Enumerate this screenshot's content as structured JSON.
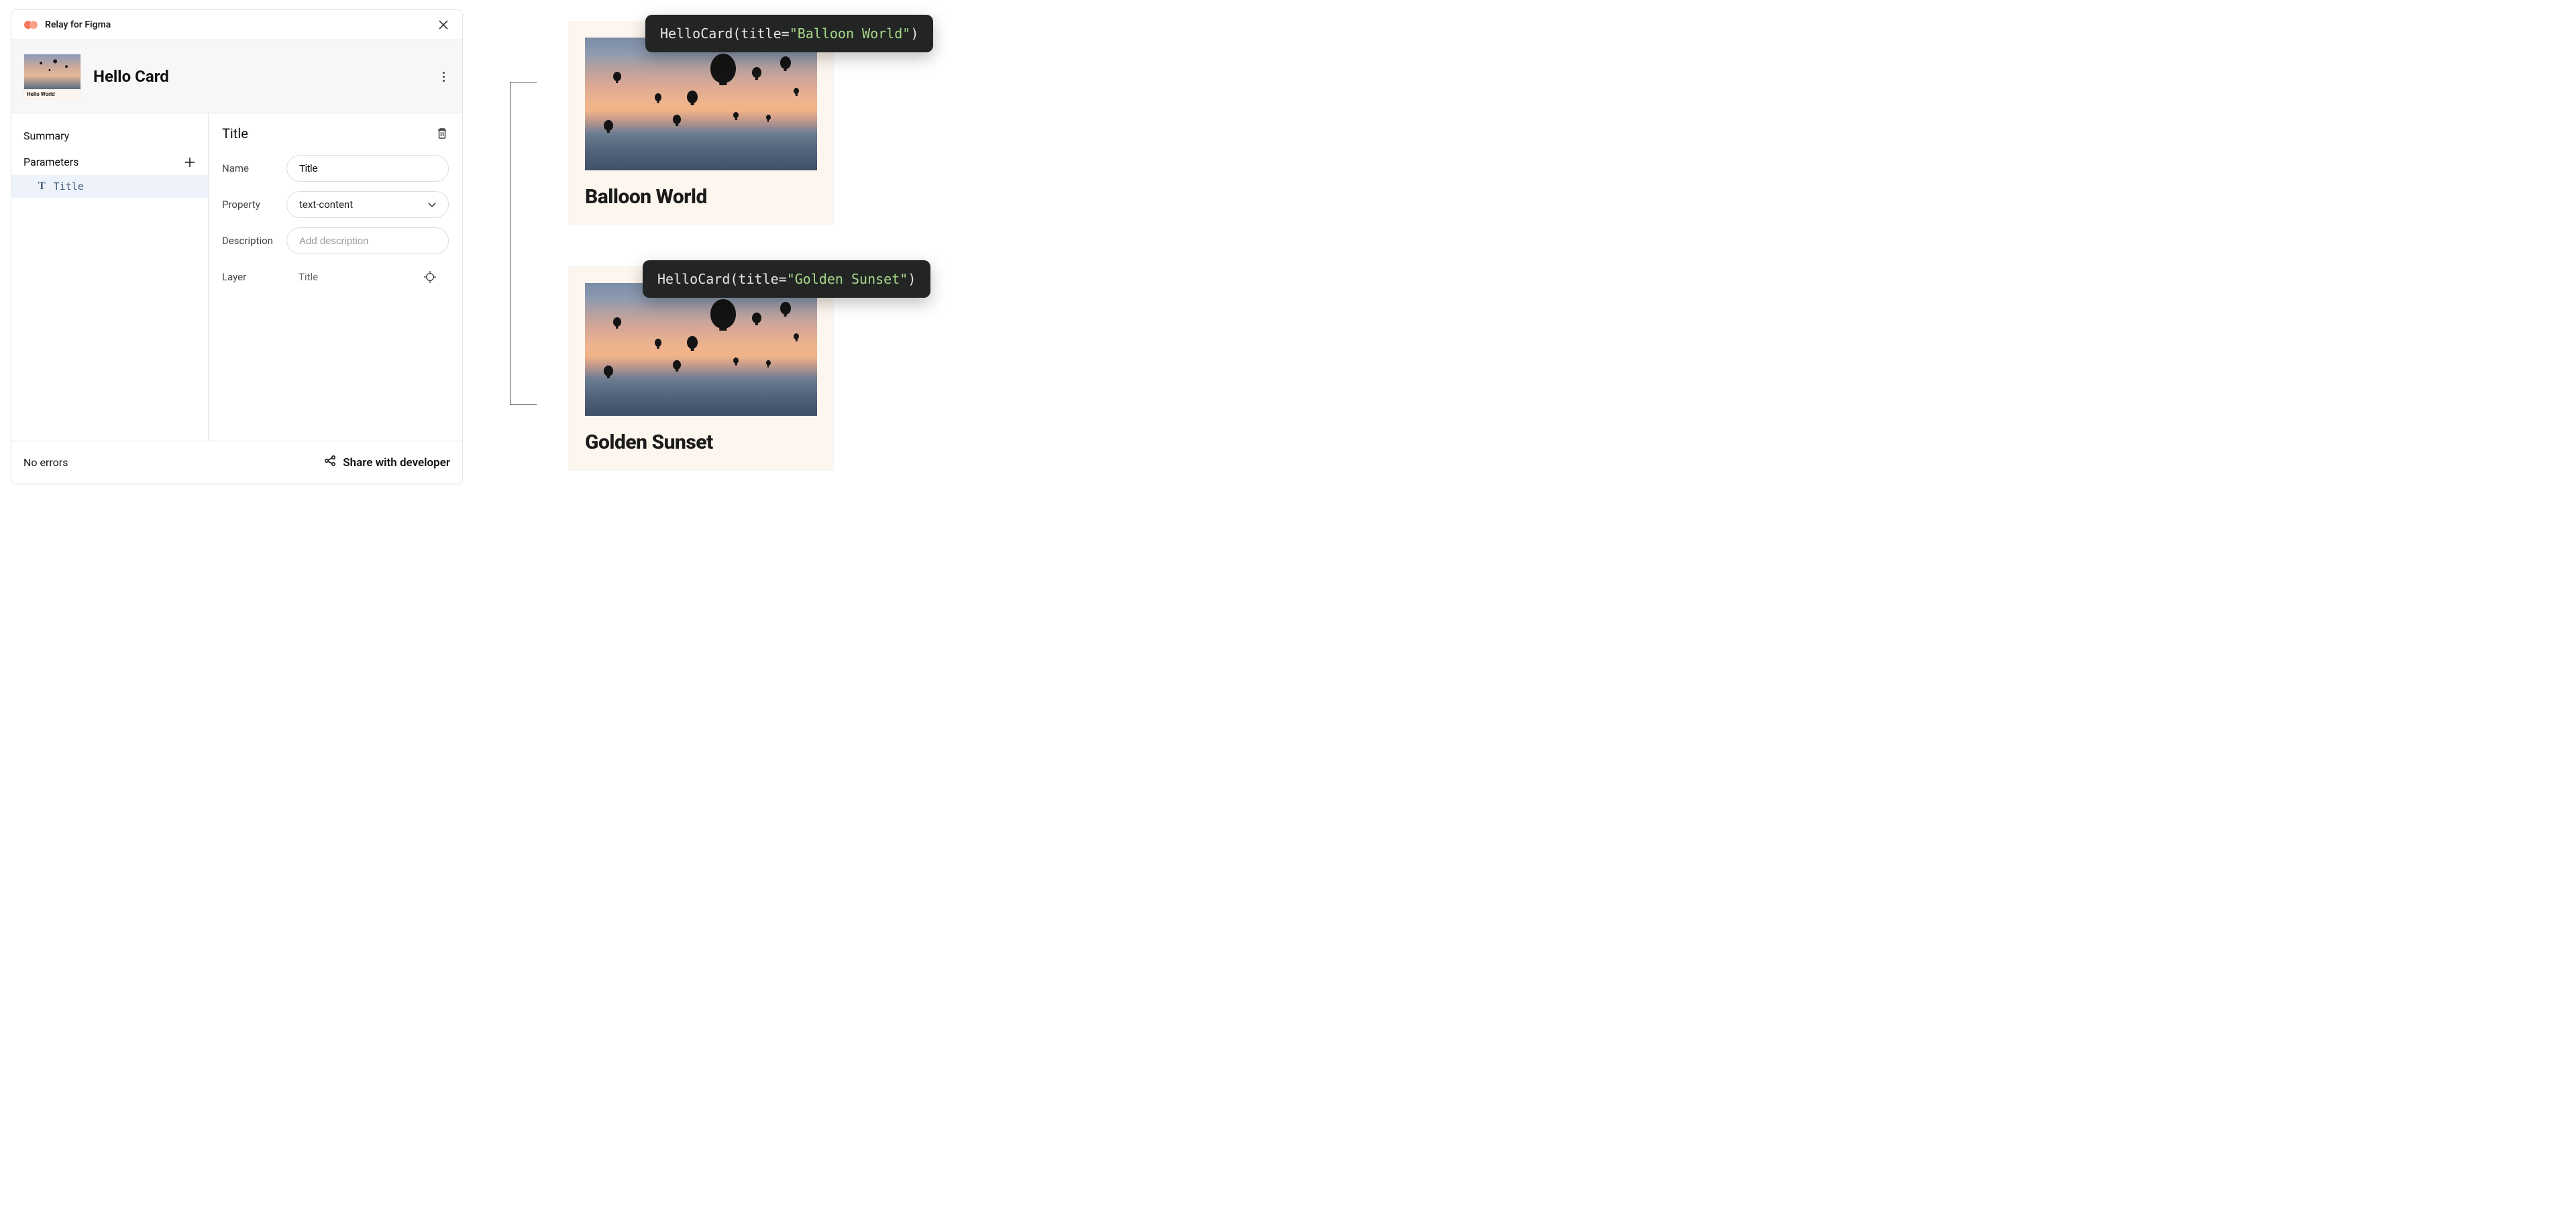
{
  "plugin": {
    "name": "Relay for Figma",
    "thumb_label": "Hello World",
    "component_title": "Hello Card"
  },
  "sidebar": {
    "summary_label": "Summary",
    "parameters_label": "Parameters",
    "params": [
      {
        "name": "Title"
      }
    ]
  },
  "detail": {
    "heading": "Title",
    "name_label": "Name",
    "name_value": "Title",
    "property_label": "Property",
    "property_value": "text-content",
    "description_label": "Description",
    "description_placeholder": "Add description",
    "layer_label": "Layer",
    "layer_value": "Title"
  },
  "footer": {
    "status": "No errors",
    "share_label": "Share with developer"
  },
  "previews": {
    "card1": {
      "title": "Balloon World",
      "code_fn": "HelloCard",
      "code_param": "title",
      "code_value": "\"Balloon World\""
    },
    "card2": {
      "title": "Golden Sunset",
      "code_fn": "HelloCard",
      "code_param": "title",
      "code_value": "\"Golden Sunset\""
    }
  }
}
